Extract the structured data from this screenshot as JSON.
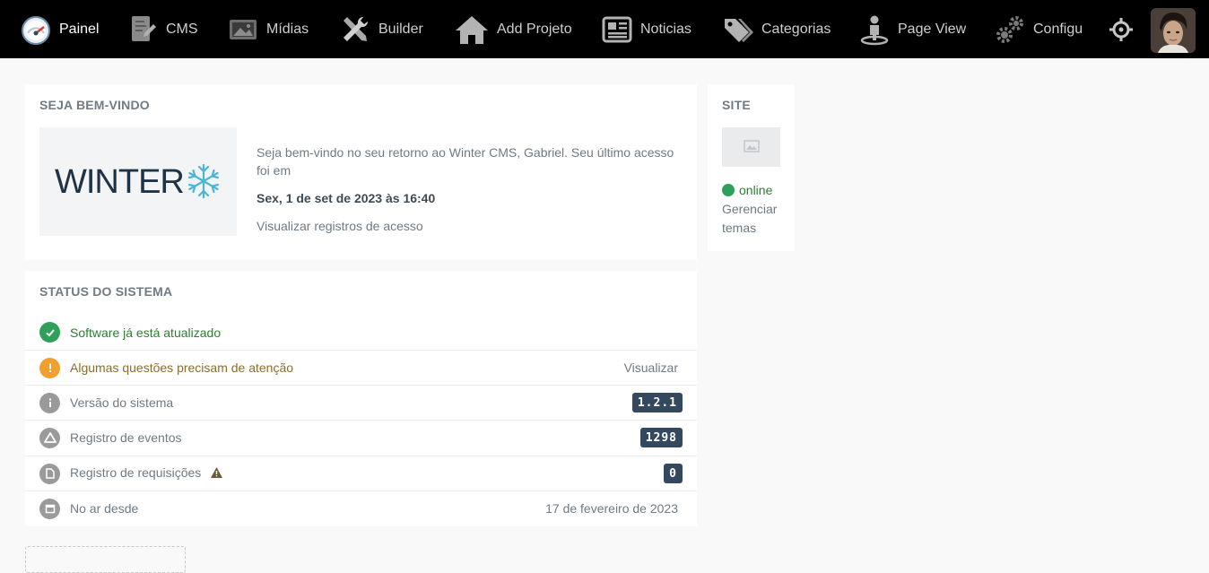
{
  "nav": {
    "items": [
      {
        "label": "Painel",
        "icon": "dashboard-gauge-icon"
      },
      {
        "label": "CMS",
        "icon": "cms-document-icon"
      },
      {
        "label": "Mídias",
        "icon": "media-image-icon"
      },
      {
        "label": "Builder",
        "icon": "builder-tools-icon"
      },
      {
        "label": "Add Projeto",
        "icon": "home-icon"
      },
      {
        "label": "Noticias",
        "icon": "news-icon"
      },
      {
        "label": "Categorias",
        "icon": "tags-icon"
      },
      {
        "label": "Page View",
        "icon": "user-pin-icon"
      },
      {
        "label": "Configu",
        "icon": "gears-icon"
      }
    ],
    "extra_icon": "crosshair-icon",
    "avatar": "user-avatar"
  },
  "welcome": {
    "title": "SEJA BEM-VINDO",
    "logo_text": "WINTER",
    "message": "Seja bem-vindo no seu retorno ao Winter CMS, Gabriel. Seu último acesso foi em",
    "last_access": "Sex, 1 de set de 2023 às 16:40",
    "link": "Visualizar registros de acesso"
  },
  "site": {
    "title": "SITE",
    "status": "online",
    "manage": "Gerenciar temas"
  },
  "status": {
    "title": "STATUS DO SISTEMA",
    "rows": [
      {
        "label": "Software já está atualizado",
        "icon": "check-circle-icon",
        "color": "#2fa05a"
      },
      {
        "label": "Algumas questões precisam de atenção",
        "right": "Visualizar",
        "icon": "exclamation-circle-icon",
        "color": "#f0a030"
      },
      {
        "label": "Versão do sistema",
        "badge": "1.2.1",
        "icon": "info-circle-icon",
        "color": "#9a9a9a"
      },
      {
        "label": "Registro de eventos",
        "badge": "1298",
        "icon": "warning-triangle-icon",
        "color": "#9a9a9a"
      },
      {
        "label": "Registro de requisições",
        "badge": "0",
        "icon": "file-icon",
        "color": "#9a9a9a"
      },
      {
        "label": "No ar desde",
        "right": "17 de fevereiro de 2023",
        "icon": "calendar-icon",
        "color": "#9a9a9a"
      }
    ]
  },
  "colors": {
    "topbar": "#000000",
    "badge": "#34495e",
    "success": "#2fa05a",
    "warning": "#f0a030"
  }
}
